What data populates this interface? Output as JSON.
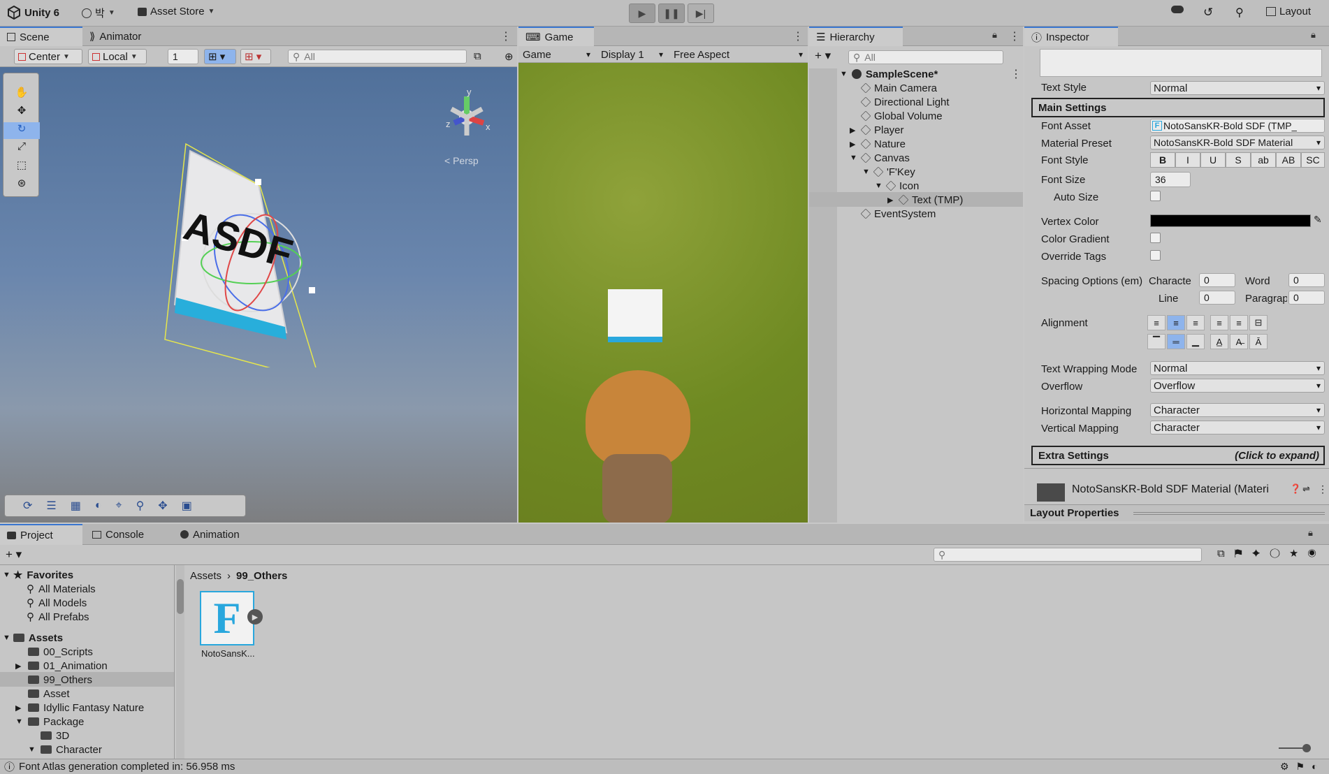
{
  "toolbar": {
    "app_title": "Unity 6",
    "account_label": "박",
    "asset_store_label": "Asset Store",
    "layout_label": "Layout"
  },
  "scene": {
    "tab_scene": "Scene",
    "tab_animator": "Animator",
    "pivot_label": "Center",
    "space_label": "Local",
    "grid_value": "1",
    "search_placeholder": "All",
    "persp_label": "< Persp",
    "gizmo_y": "y",
    "gizmo_x": "x",
    "gizmo_z": "z",
    "object_text": "ASDF"
  },
  "game": {
    "tab_label": "Game",
    "mode_label": "Game",
    "display_label": "Display 1",
    "aspect_label": "Free Aspect"
  },
  "hierarchy": {
    "tab_label": "Hierarchy",
    "search_placeholder": "All",
    "scene_name": "SampleScene*",
    "items": [
      {
        "label": "Main Camera"
      },
      {
        "label": "Directional Light"
      },
      {
        "label": "Global Volume"
      },
      {
        "label": "Player"
      },
      {
        "label": "Nature"
      },
      {
        "label": "Canvas"
      },
      {
        "label": "'F'Key"
      },
      {
        "label": "Icon"
      },
      {
        "label": "Text (TMP)"
      },
      {
        "label": "EventSystem"
      }
    ]
  },
  "inspector": {
    "tab_label": "Inspector",
    "text_style_label": "Text Style",
    "text_style_value": "Normal",
    "main_settings": "Main Settings",
    "font_asset_label": "Font Asset",
    "font_asset_value": "NotoSansKR-Bold SDF (TMP_",
    "material_preset_label": "Material Preset",
    "material_preset_value": "NotoSansKR-Bold SDF Material",
    "font_style_label": "Font Style",
    "font_style_buttons": [
      "B",
      "I",
      "U",
      "S",
      "ab",
      "AB",
      "SC"
    ],
    "font_size_label": "Font Size",
    "font_size_value": "36",
    "auto_size_label": "Auto Size",
    "vertex_color_label": "Vertex Color",
    "vertex_color": "#000000",
    "color_gradient_label": "Color Gradient",
    "override_tags_label": "Override Tags",
    "spacing_label": "Spacing Options (em)",
    "character_label": "Characte",
    "character_value": "0",
    "word_label": "Word",
    "word_value": "0",
    "line_label": "Line",
    "line_value": "0",
    "paragraph_label": "Paragrapl",
    "paragraph_value": "0",
    "alignment_label": "Alignment",
    "wrap_label": "Text Wrapping Mode",
    "wrap_value": "Normal",
    "overflow_label": "Overflow",
    "overflow_value": "Overflow",
    "hmap_label": "Horizontal Mapping",
    "hmap_value": "Character",
    "vmap_label": "Vertical Mapping",
    "vmap_value": "Character",
    "extra_settings": "Extra Settings",
    "extra_hint": "(Click to expand)",
    "material_name": "NotoSansKR-Bold SDF Material (Materi",
    "layout_properties": "Layout Properties"
  },
  "project": {
    "tab_project": "Project",
    "tab_console": "Console",
    "tab_animation": "Animation",
    "favorites_label": "Favorites",
    "favorites": [
      {
        "label": "All Materials"
      },
      {
        "label": "All Models"
      },
      {
        "label": "All Prefabs"
      }
    ],
    "assets_label": "Assets",
    "folders": [
      {
        "label": "00_Scripts"
      },
      {
        "label": "01_Animation"
      },
      {
        "label": "99_Others"
      },
      {
        "label": "Asset"
      },
      {
        "label": "Idyllic Fantasy Nature"
      },
      {
        "label": "Package"
      },
      {
        "label": "3D"
      },
      {
        "label": "Character"
      }
    ],
    "breadcrumb_root": "Assets",
    "breadcrumb_current": "99_Others",
    "asset_name": "NotoSansK...",
    "asset_letter": "F"
  },
  "status": {
    "message": "Font Atlas generation completed in: 56.958 ms"
  }
}
